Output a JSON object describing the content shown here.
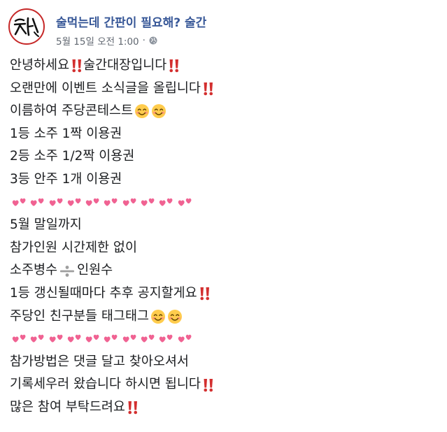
{
  "post": {
    "page_name": "술먹는데 간판이 필요해? 술간",
    "timestamp": "5월 15일 오전 1:00",
    "separator": "·",
    "avatar_icon": "brand-logo-icon",
    "privacy_icon": "globe-icon"
  },
  "body": {
    "l1": {
      "a": "안녕하세요",
      "b": " 술간대장입니다"
    },
    "l2": {
      "a": "오랜만에 이벤트 소식글을 올립니다"
    },
    "l3": {
      "a": "이름하여 주당콘테스트"
    },
    "l4": "1등 소주 1짝 이용권",
    "l5": "2등 소주 1/2짝 이용권",
    "l6": "3등 안주 1개 이용권",
    "l8": "5월 말일까지",
    "l9": "참가인원 시간제한 없이",
    "l10": {
      "a": "소주병수",
      "b": "인원수"
    },
    "l11": {
      "a": "1등 갱신될때마다 추후 공지할게요"
    },
    "l12": {
      "a": "주당인 친구분들 태그태그"
    },
    "l14": "참가방법은 댓글 달고 찾아오셔서",
    "l15": {
      "a": "기록세우러 왔습니다 하시면 됩니다"
    },
    "l16": {
      "a": "많은 참여 부탁드려요"
    }
  },
  "emoji_colors": {
    "bang": "#d32f2f",
    "heart": "#f06292",
    "smile_face": "#ffcc4d",
    "divide": "#9e9e9e"
  },
  "heart_rows": [
    10,
    10
  ]
}
